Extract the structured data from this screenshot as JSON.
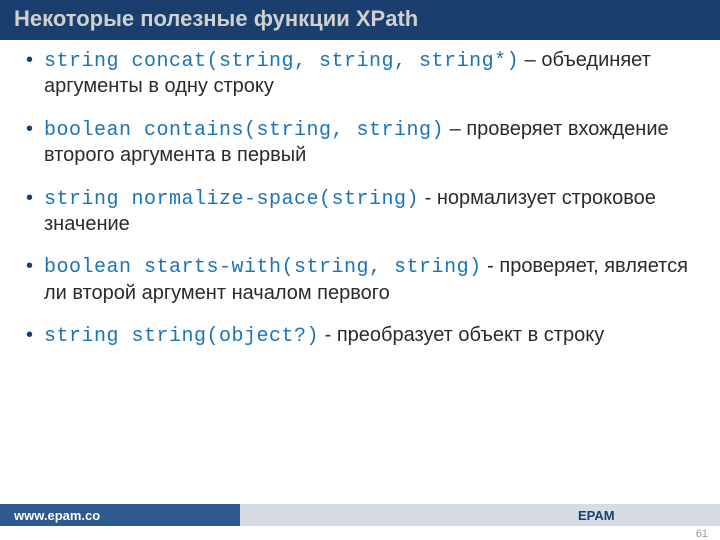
{
  "title": "Некоторые полезные функции XPath",
  "items": [
    {
      "code": "string concat(string, string, string*)",
      "sep": " – ",
      "desc": "объединяет аргументы в одну строку"
    },
    {
      "code": "boolean contains(string, string)",
      "sep": " – ",
      "desc": "проверяет вхождение второго аргумента в первый"
    },
    {
      "code": "string normalize-space(string)",
      "sep": " - ",
      "desc": "нормализует строковое значение"
    },
    {
      "code": "boolean starts-with(string, string)",
      "sep": " - ",
      "desc": "проверяет, является ли второй аргумент началом первого"
    },
    {
      "code": "string string(object?)",
      "sep": " - ",
      "desc": "преобразует объект в строку"
    }
  ],
  "footer": {
    "url": "www.epam.co",
    "brand": "EPAM"
  },
  "page": "61"
}
